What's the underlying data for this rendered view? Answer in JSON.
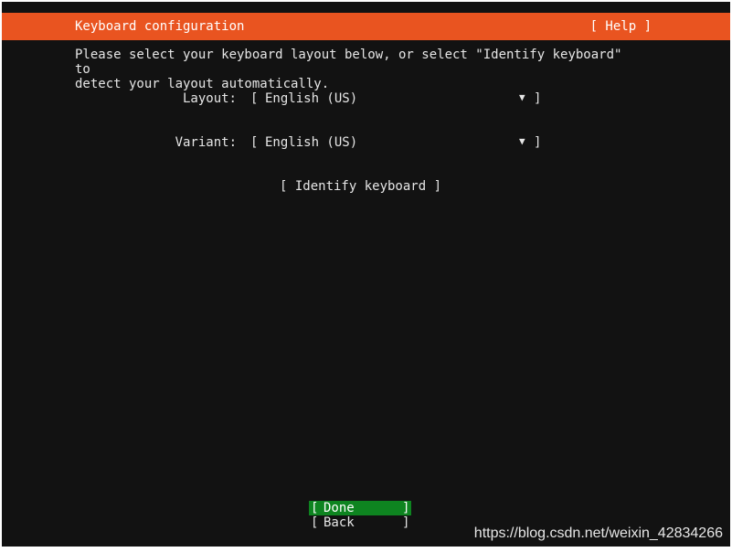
{
  "header": {
    "title": "Keyboard configuration",
    "help_label": "[ Help ]",
    "color": "#e95420"
  },
  "intro": "Please select your keyboard layout below, or select \"Identify keyboard\" to\ndetect your layout automatically.",
  "form": {
    "layout": {
      "label": "Layout:",
      "bracket_open": "[",
      "value": "English (US)",
      "arrow": "▼",
      "bracket_close": "]"
    },
    "variant": {
      "label": "Variant:",
      "bracket_open": "[",
      "value": "English (US)",
      "arrow": "▼",
      "bracket_close": "]"
    },
    "identify_label": "[ Identify keyboard ]"
  },
  "footer": {
    "done": {
      "bracket_open": "[",
      "label": "Done",
      "bracket_close": "]",
      "color": "#0e8420"
    },
    "back": {
      "bracket_open": "[",
      "label": "Back",
      "bracket_close": "]"
    }
  },
  "watermark": "https://blog.csdn.net/weixin_42834266"
}
